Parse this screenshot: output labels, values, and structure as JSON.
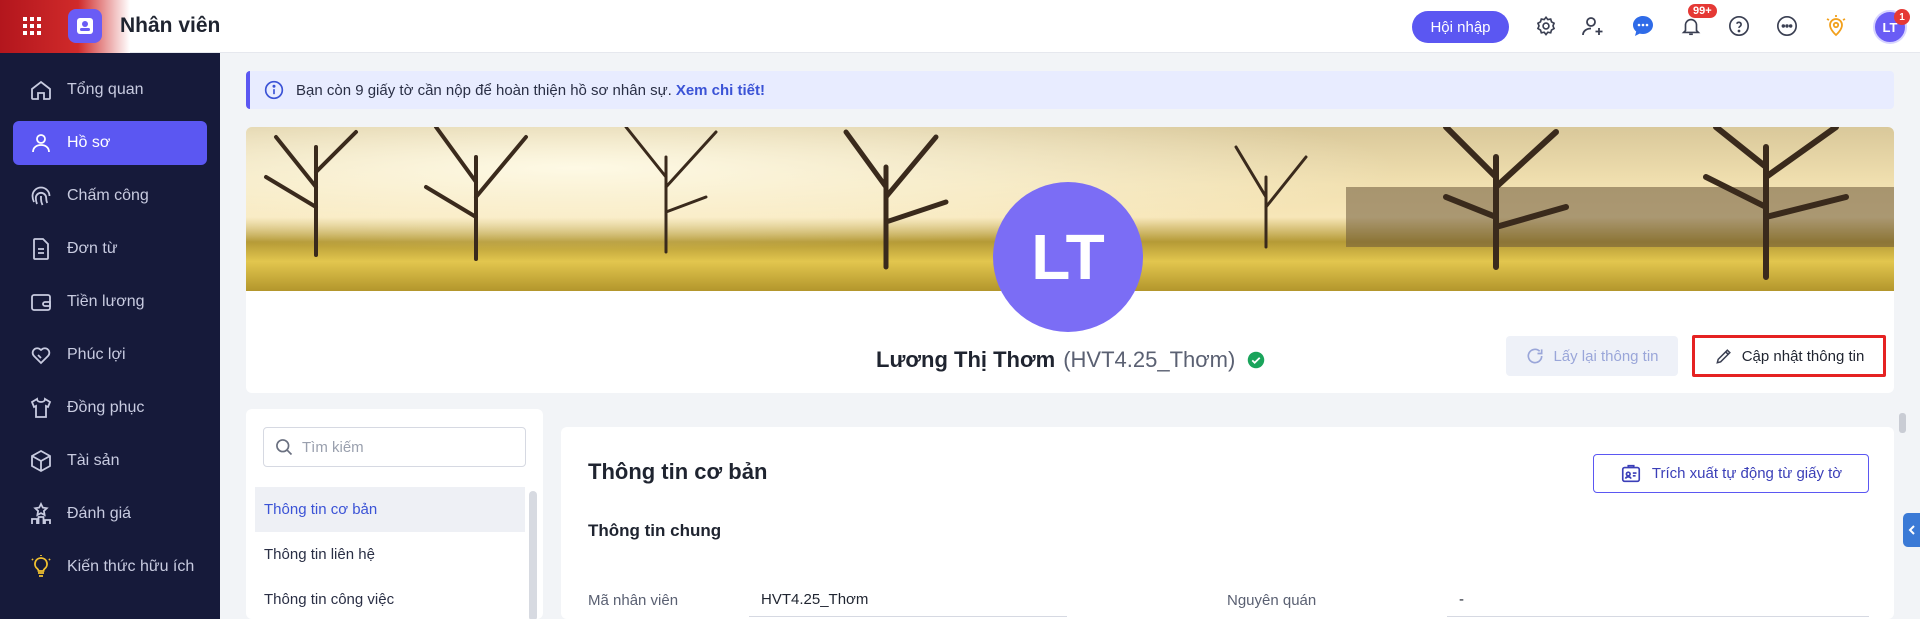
{
  "topbar": {
    "app_title": "Nhân viên",
    "join_button": "Hội nhập",
    "notification_badge": "99+",
    "avatar_initials": "LT",
    "avatar_badge": "1",
    "brand_color": "#5b57f2"
  },
  "sidebar": {
    "items": [
      {
        "label": "Tổng quan",
        "icon": "home-icon"
      },
      {
        "label": "Hồ sơ",
        "icon": "user-icon",
        "active": true
      },
      {
        "label": "Chấm công",
        "icon": "fingerprint-icon"
      },
      {
        "label": "Đơn từ",
        "icon": "document-icon"
      },
      {
        "label": "Tiền lương",
        "icon": "wallet-icon"
      },
      {
        "label": "Phúc lợi",
        "icon": "handshake-icon"
      },
      {
        "label": "Đồng phục",
        "icon": "shirt-icon"
      },
      {
        "label": "Tài sản",
        "icon": "box-icon"
      },
      {
        "label": "Đánh giá",
        "icon": "ranking-icon"
      },
      {
        "label": "Kiến thức hữu ích",
        "icon": "lightbulb-icon"
      }
    ]
  },
  "notice": {
    "text": "Bạn còn 9 giấy tờ cần nộp để hoàn thiện hồ sơ nhân sự.",
    "link": "Xem chi tiết!"
  },
  "profile": {
    "initials": "LT",
    "name": "Lương Thị Thơm",
    "code": "(HVT4.25_Thơm)",
    "reload_button": "Lấy lại thông tin",
    "update_button": "Cập nhật thông tin"
  },
  "sections": {
    "search_placeholder": "Tìm kiếm",
    "items": [
      "Thông tin cơ bản",
      "Thông tin liên hệ",
      "Thông tin công việc"
    ]
  },
  "content": {
    "title": "Thông tin cơ bản",
    "extract_button": "Trích xuất tự động từ giấy tờ",
    "subtitle": "Thông tin chung",
    "fields": [
      {
        "label": "Mã nhân viên",
        "value": "HVT4.25_Thơm"
      },
      {
        "label": "Nguyên quán",
        "value": "-"
      }
    ]
  }
}
